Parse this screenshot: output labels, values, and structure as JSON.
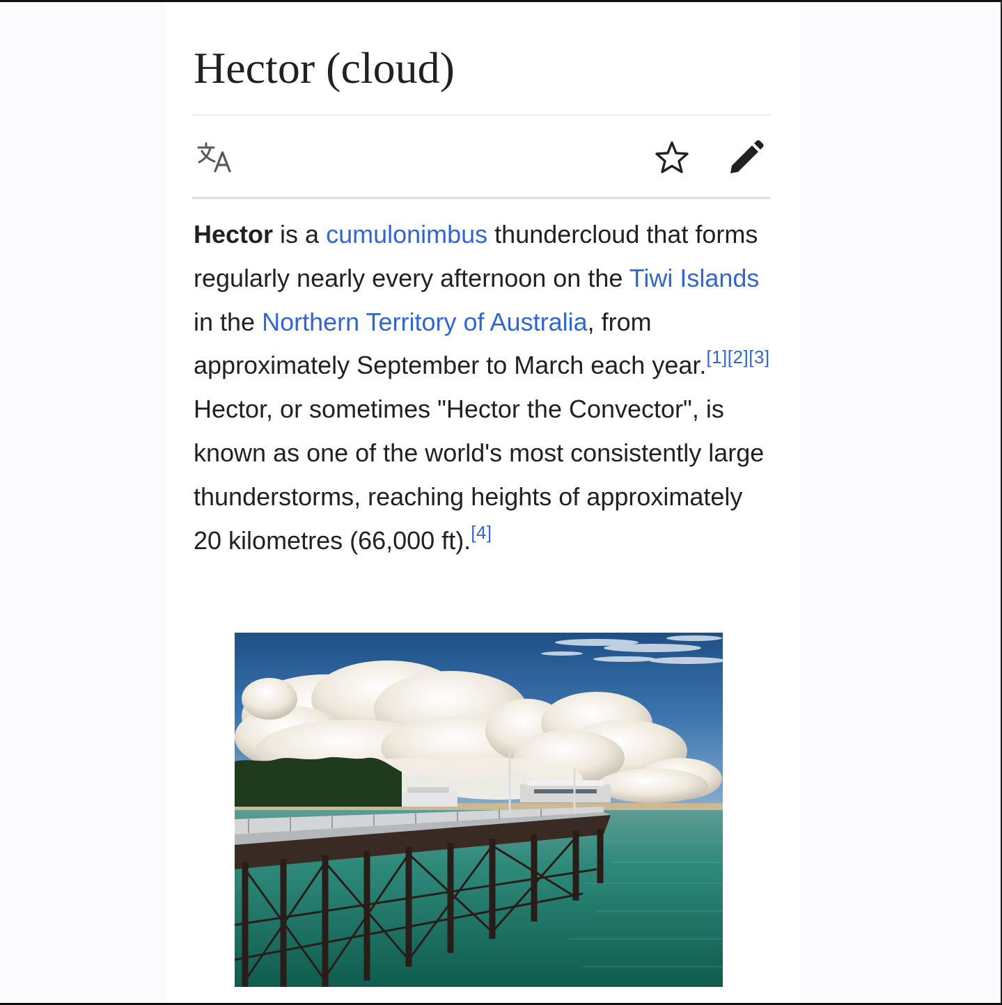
{
  "article": {
    "title": "Hector (cloud)"
  },
  "toolbar": {
    "language_icon": "translate-icon",
    "watch_icon": "star-icon",
    "edit_icon": "pencil-icon"
  },
  "intro": {
    "bold_subject": "Hector",
    "text_1": " is a ",
    "link_cumulonimbus": "cumulonimbus",
    "text_2": " thundercloud that forms regularly nearly every afternoon on the ",
    "link_tiwi_islands": "Tiwi Islands",
    "text_3": " in the ",
    "link_northern_territory": "Northern Territory of Australia",
    "text_4": ", from approximately September to March each year.",
    "ref_1": "[1]",
    "ref_2": "[2]",
    "ref_3": "[3]",
    "text_5": " Hector, or sometimes \"Hector the Convector\", is known as one of the world's most consistently large thunderstorms, reaching heights of approximately 20 kilometres (66,000 ft).",
    "ref_4": "[4]"
  },
  "colors": {
    "link": "#3366cc",
    "text": "#202122",
    "divider": "#eaecf0"
  }
}
